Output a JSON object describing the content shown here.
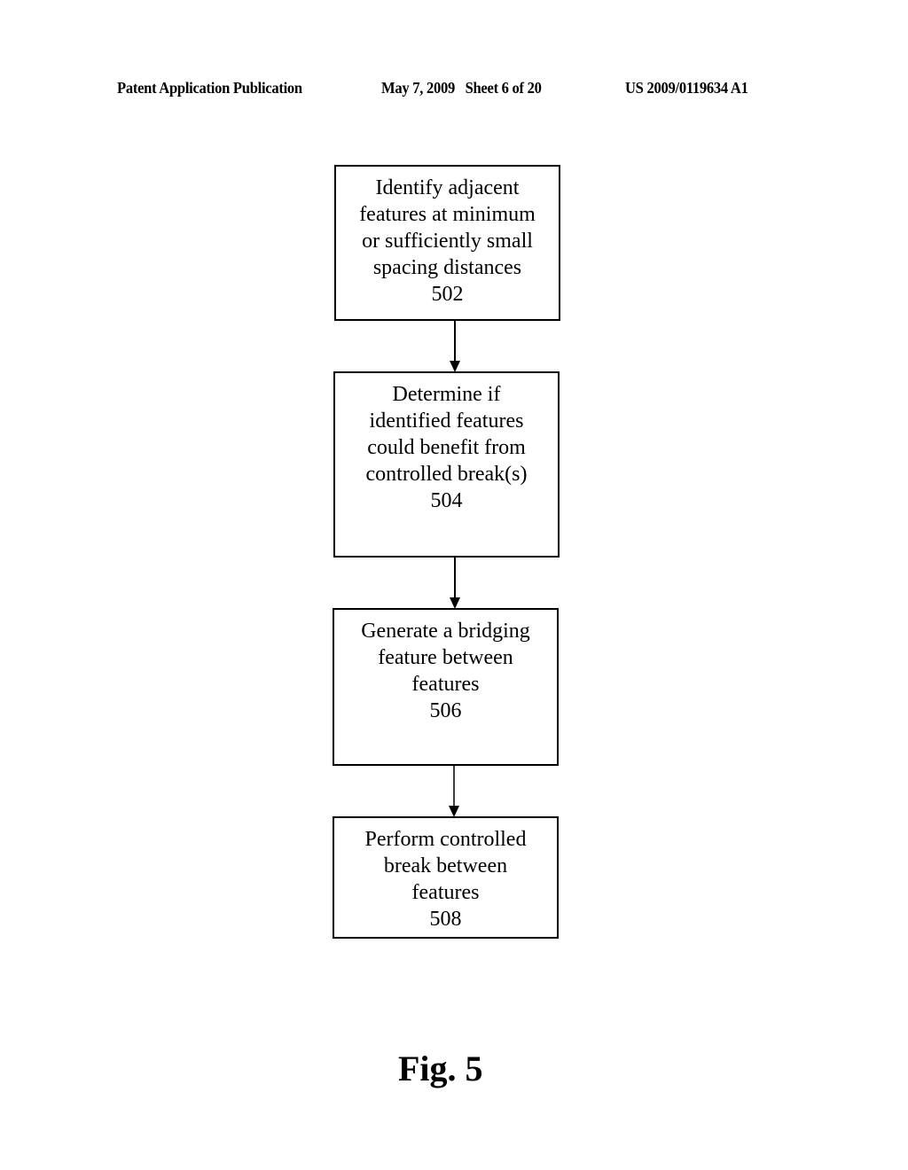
{
  "header": {
    "left": "Patent Application Publication",
    "middle": "May 7, 2009   Sheet 6 of 20",
    "right": "US 2009/0119634 A1"
  },
  "flowchart": {
    "steps": [
      {
        "id": "502",
        "lines": [
          "Identify adjacent",
          "features at minimum",
          "or sufficiently small",
          "spacing distances"
        ],
        "ref": "502"
      },
      {
        "id": "504",
        "lines": [
          "Determine if",
          "identified features",
          "could benefit from",
          "controlled break(s)"
        ],
        "ref": "504"
      },
      {
        "id": "506",
        "lines": [
          "Generate a bridging",
          "feature between",
          "features"
        ],
        "ref": "506"
      },
      {
        "id": "508",
        "lines": [
          "Perform controlled",
          "break between",
          "features"
        ],
        "ref": "508"
      }
    ],
    "connections": [
      {
        "from": "502",
        "to": "504"
      },
      {
        "from": "504",
        "to": "506"
      },
      {
        "from": "506",
        "to": "508"
      }
    ]
  },
  "figure_label": "Fig. 5"
}
